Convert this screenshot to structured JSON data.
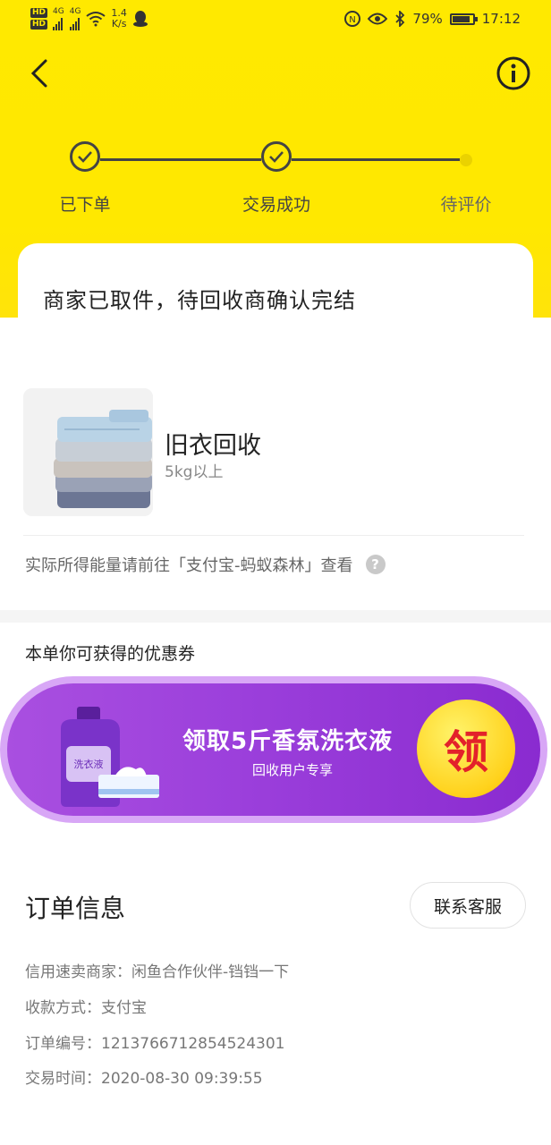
{
  "status_bar": {
    "hd1": "HD",
    "hd2": "HD",
    "net1": "4G",
    "net2": "4G",
    "speed_value": "1.4",
    "speed_unit": "K/s",
    "battery_percent": "79%",
    "battery_level": 0.79,
    "time": "17:12"
  },
  "progress": {
    "steps": [
      {
        "label": "已下单",
        "state": "done"
      },
      {
        "label": "交易成功",
        "state": "done"
      },
      {
        "label": "待评价",
        "state": "pending"
      }
    ]
  },
  "status": {
    "message": "商家已取件，待回收商确认完结"
  },
  "product": {
    "name": "旧衣回收",
    "spec": "5kg以上",
    "note": "实际所得能量请前往「支付宝-蚂蚁森林」查看"
  },
  "coupon": {
    "section_title": "本单你可获得的优惠券",
    "main_text": "领取5斤香氛洗衣液",
    "sub_text": "回收用户专享",
    "button_label": "领",
    "product_label": "洗衣液"
  },
  "order": {
    "title": "订单信息",
    "contact_label": "联系客服",
    "rows": [
      {
        "label": "信用速卖商家：",
        "value": "闲鱼合作伙伴-铛铛一下"
      },
      {
        "label": "收款方式：",
        "value": "支付宝"
      },
      {
        "label": "订单编号：",
        "value": "1213766712854524301"
      },
      {
        "label": "交易时间：",
        "value": "2020-08-30 09:39:55"
      }
    ]
  },
  "colors": {
    "header_yellow": "#FFE900",
    "coupon_purple": "#9B3FDB",
    "coupon_button": "#FFD21C"
  }
}
